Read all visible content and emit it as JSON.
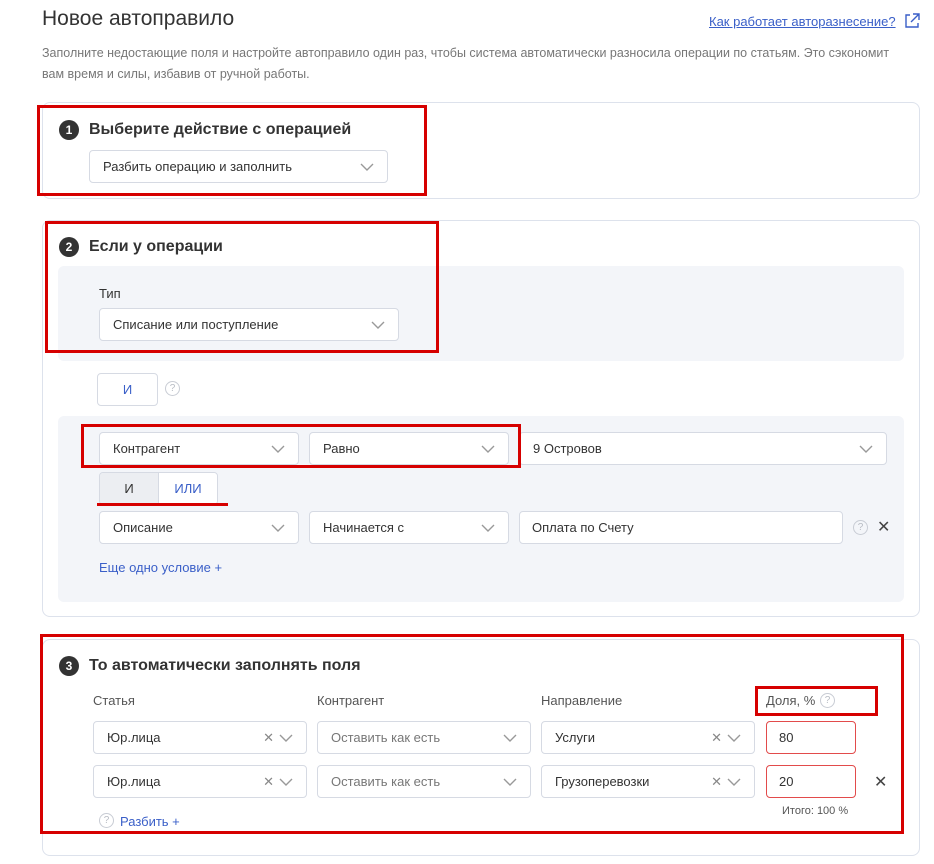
{
  "page": {
    "title": "Новое автоправило",
    "help_link": "Как работает авторазнесение?",
    "subtitle": "Заполните недостающие поля и настройте автоправило один раз, чтобы система автоматически разносила операции по статьям. Это сэкономит вам время и силы, избавив от ручной работы."
  },
  "step1": {
    "num": "1",
    "title": "Выберите действие с операцией",
    "action_value": "Разбить операцию и заполнить"
  },
  "step2": {
    "num": "2",
    "title": "Если у операции",
    "type_label": "Тип",
    "type_value": "Списание или поступление",
    "and_button": "И",
    "conditions": [
      {
        "field": "Контрагент",
        "operator": "Равно",
        "value": "9 Островов"
      },
      {
        "field": "Описание",
        "operator": "Начинается с",
        "value": "Оплата по Счету"
      }
    ],
    "logic": {
      "and": "И",
      "or": "ИЛИ"
    },
    "add_condition": "Еще одно условие +"
  },
  "step3": {
    "num": "3",
    "title": "То автоматически заполнять поля",
    "columns": {
      "article": "Статья",
      "counterparty": "Контрагент",
      "direction": "Направление",
      "share": "Доля, %"
    },
    "rows": [
      {
        "article": "Юр.лица",
        "counterparty": "Оставить как есть",
        "direction": "Услуги",
        "share": "80"
      },
      {
        "article": "Юр.лица",
        "counterparty": "Оставить как есть",
        "direction": "Грузоперевозки",
        "share": "20"
      }
    ],
    "total": "Итого: 100 %",
    "split_link": "Разбить +"
  },
  "icons": {
    "external": "external-link-icon",
    "chevron": "chevron-down-icon",
    "help": "help-circle-icon",
    "close": "close-icon"
  },
  "colors": {
    "accent": "#3a5fc8",
    "highlight": "#d60000",
    "error": "#e24b4b"
  }
}
